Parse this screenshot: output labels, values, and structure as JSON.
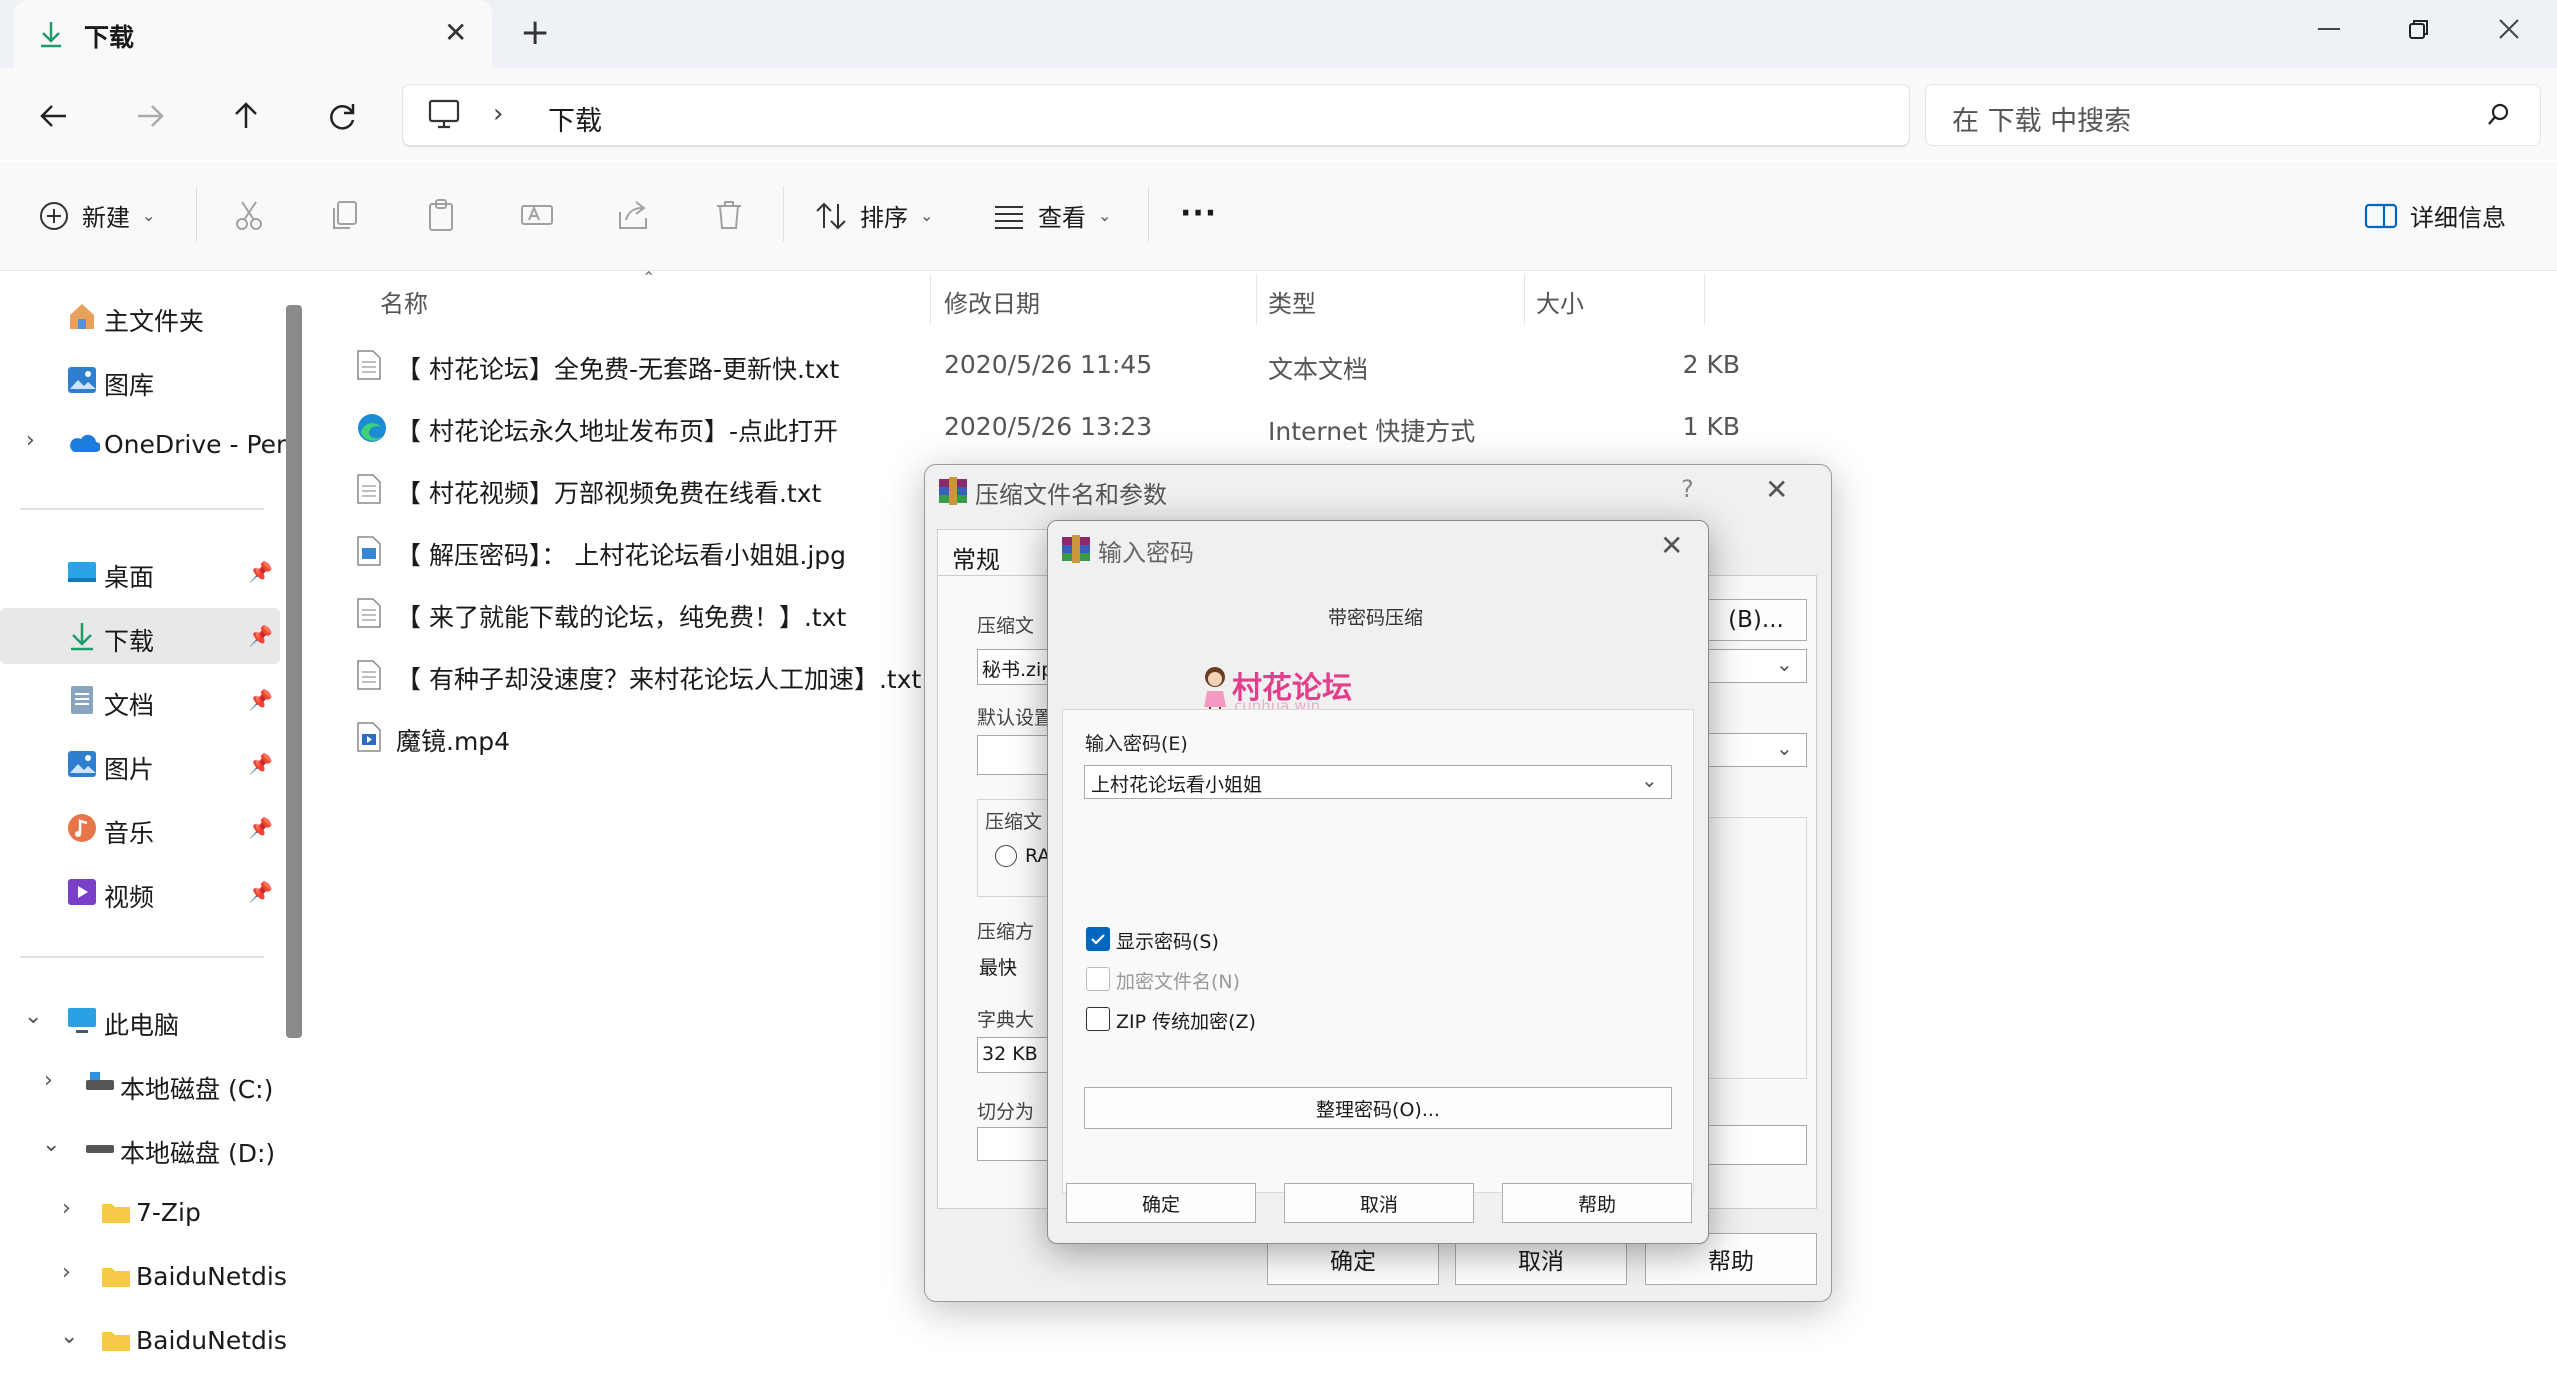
{
  "window": {
    "tab_title": "下载",
    "new_tab": "+",
    "minimize": "—",
    "close": "✕"
  },
  "nav": {
    "path_separator": "›",
    "location": "下载",
    "search_placeholder": "在 下载 中搜索"
  },
  "toolbar": {
    "new_label": "新建",
    "sort_label": "排序",
    "view_label": "查看",
    "more_label": "···",
    "details_label": "详细信息"
  },
  "sidebar": {
    "quick": [
      {
        "label": "主文件夹"
      },
      {
        "label": "图库"
      },
      {
        "label": "OneDrive - Per"
      }
    ],
    "pinned": [
      {
        "label": "桌面"
      },
      {
        "label": "下载"
      },
      {
        "label": "文档"
      },
      {
        "label": "图片"
      },
      {
        "label": "音乐"
      },
      {
        "label": "视频"
      }
    ],
    "computer": [
      {
        "label": "此电脑"
      },
      {
        "label": "本地磁盘 (C:)"
      },
      {
        "label": "本地磁盘 (D:)"
      },
      {
        "label": "7-Zip"
      },
      {
        "label": "BaiduNetdis"
      },
      {
        "label": "BaiduNetdis"
      }
    ]
  },
  "filelist": {
    "columns": {
      "name": "名称",
      "date": "修改日期",
      "type": "类型",
      "size": "大小"
    },
    "rows": [
      {
        "name": "【 村花论坛】全免费-无套路-更新快.txt",
        "date": "2020/5/26 11:45",
        "type": "文本文档",
        "size": "2 KB",
        "icon": "text-file-icon"
      },
      {
        "name": "【 村花论坛永久地址发布页】-点此打开",
        "date": "2020/5/26 13:23",
        "type": "Internet 快捷方式",
        "size": "1 KB",
        "icon": "edge-icon"
      },
      {
        "name": "【 村花视频】万部视频免费在线看.txt",
        "date": "",
        "type": "",
        "size": "",
        "icon": "text-file-icon"
      },
      {
        "name": "【 解压密码】： 上村花论坛看小姐姐.jpg",
        "date": "",
        "type": "",
        "size": "",
        "icon": "image-file-icon"
      },
      {
        "name": "【 来了就能下载的论坛，纯免费！】.txt",
        "date": "",
        "type": "",
        "size": "",
        "icon": "text-file-icon"
      },
      {
        "name": "【 有种子却没速度？来村花论坛人工加速】.txt",
        "date": "",
        "type": "",
        "size": "",
        "icon": "text-file-icon"
      },
      {
        "name": "魔镜.mp4",
        "date": "",
        "type": "",
        "size": "",
        "icon": "video-file-icon"
      }
    ]
  },
  "archive_dialog": {
    "title": "压缩文件名和参数",
    "help": "?",
    "close": "✕",
    "tab_general": "常规",
    "label_filename": "压缩文",
    "filename_value": "秘书.zip",
    "browse_button": "(B)...",
    "label_default": "默认设置",
    "label_format": "压缩文",
    "radio_rar": "RA",
    "label_method": "压缩方",
    "method_value": "最快",
    "label_dict": "字典大",
    "dict_value": "32 KB",
    "label_split": "切分为",
    "ok": "确定",
    "cancel": "取消",
    "help_button": "帮助"
  },
  "password_dialog": {
    "title": "输入密码",
    "close": "✕",
    "subtitle": "带密码压缩",
    "watermark": "村花论坛",
    "watermark_url": "cunhua.win",
    "label_password": "输入密码(E)",
    "password_value": "上村花论坛看小姐姐",
    "show_password": "显示密码(S)",
    "encrypt_names": "加密文件名(N)",
    "zip_legacy": "ZIP 传统加密(Z)",
    "organize": "整理密码(O)...",
    "ok": "确定",
    "cancel": "取消",
    "help": "帮助",
    "show_password_checked": true,
    "encrypt_names_checked": false,
    "zip_legacy_checked": false
  },
  "colors": {
    "accent": "#0067c0",
    "folder": "#f7c948",
    "watermark": "#e43d8c"
  }
}
